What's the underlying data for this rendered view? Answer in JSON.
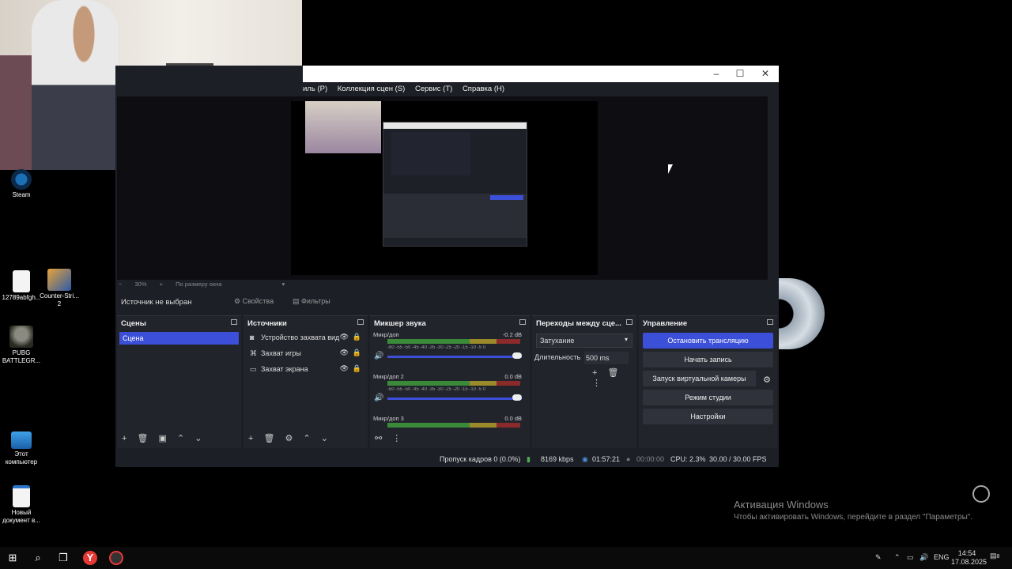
{
  "desktop": {
    "icons": [
      {
        "label": "Steam",
        "icon": "steam-icon"
      },
      {
        "label": "12789abfgh...",
        "icon": "file-icon"
      },
      {
        "label": "Counter-Stri... 2",
        "icon": "cs2-icon"
      },
      {
        "label": "PUBG BATTLEGR...",
        "icon": "pubg-icon"
      },
      {
        "label": "Этот компьютер",
        "icon": "computer-icon"
      },
      {
        "label": "Новый документ в...",
        "icon": "document-icon"
      }
    ],
    "activation": {
      "title": "Активация Windows",
      "subtitle": "Чтобы активировать Windows, перейдите в раздел \"Параметры\"."
    }
  },
  "obs": {
    "menu": [
      "иль (P)",
      "Коллекция сцен (S)",
      "Сервис (T)",
      "Справка (H)"
    ],
    "zoom": {
      "minus": "−",
      "percent": "30%",
      "plus": "+",
      "fit": "По размеру окна"
    },
    "source_bar": {
      "no_source": "Источник не выбран",
      "properties": "Свойства",
      "filters": "Фильтры"
    },
    "scenes": {
      "title": "Сцены",
      "items": [
        "Сцена"
      ]
    },
    "sources": {
      "title": "Источники",
      "items": [
        {
          "label": "Устройство захвата вид",
          "icon": "camera-icon"
        },
        {
          "label": "Захват игры",
          "icon": "gamepad-icon"
        },
        {
          "label": "Захват экрана",
          "icon": "monitor-icon"
        }
      ]
    },
    "mixer": {
      "title": "Микшер звука",
      "channels": [
        {
          "name": "Микр/доп",
          "db": "-0.2 dB"
        },
        {
          "name": "Микр/доп 2",
          "db": "0.0 dB"
        },
        {
          "name": "Микр/доп 3",
          "db": "0.0 dB"
        }
      ],
      "ticks": "-60 -55 -50 -45 -40 -35 -30 -25 -20 -15 -10 -5 0"
    },
    "transitions": {
      "title": "Переходы между сце...",
      "selected": "Затухание",
      "duration_label": "Длительность",
      "duration_value": "500 ms"
    },
    "controls": {
      "title": "Управление",
      "stop_stream": "Остановить трансляцию",
      "start_record": "Начать запись",
      "virtual_cam": "Запуск виртуальной камеры",
      "studio_mode": "Режим студии",
      "settings": "Настройки"
    },
    "status": {
      "dropped": "Пропуск кадров 0 (0.0%)",
      "bitrate": "8169 kbps",
      "stream_time": "01:57:21",
      "rec_time": "00:00:00",
      "cpu": "CPU: 2.3%",
      "fps": "30.00 / 30.00 FPS"
    }
  },
  "taskbar": {
    "lang": "ENG",
    "time": "14:54",
    "date": "17.08.2025",
    "notifications": "8"
  }
}
